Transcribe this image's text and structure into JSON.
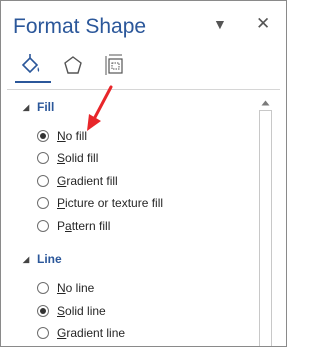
{
  "pane": {
    "title": "Format Shape",
    "menu_glyph": "▼",
    "close_glyph": "✕"
  },
  "tabs": [
    {
      "name": "fill-line",
      "icon": "paint-bucket-icon",
      "selected": true
    },
    {
      "name": "effects",
      "icon": "pentagon-icon",
      "selected": false
    },
    {
      "name": "size-properties",
      "icon": "size-layout-icon",
      "selected": false
    }
  ],
  "fill": {
    "heading": "Fill",
    "options": [
      {
        "pre": "",
        "key": "N",
        "post": "o fill",
        "selected": true
      },
      {
        "pre": "",
        "key": "S",
        "post": "olid fill",
        "selected": false
      },
      {
        "pre": "",
        "key": "G",
        "post": "radient fill",
        "selected": false
      },
      {
        "pre": "",
        "key": "P",
        "post": "icture or texture fill",
        "selected": false
      },
      {
        "pre": "P",
        "key": "a",
        "post": "ttern fill",
        "selected": false
      }
    ]
  },
  "line": {
    "heading": "Line",
    "options": [
      {
        "pre": "",
        "key": "N",
        "post": "o line",
        "selected": false
      },
      {
        "pre": "",
        "key": "S",
        "post": "olid line",
        "selected": true
      },
      {
        "pre": "",
        "key": "G",
        "post": "radient line",
        "selected": false
      }
    ]
  },
  "colors": {
    "accent": "#2b579a",
    "annotation_arrow": "#e8262a"
  }
}
